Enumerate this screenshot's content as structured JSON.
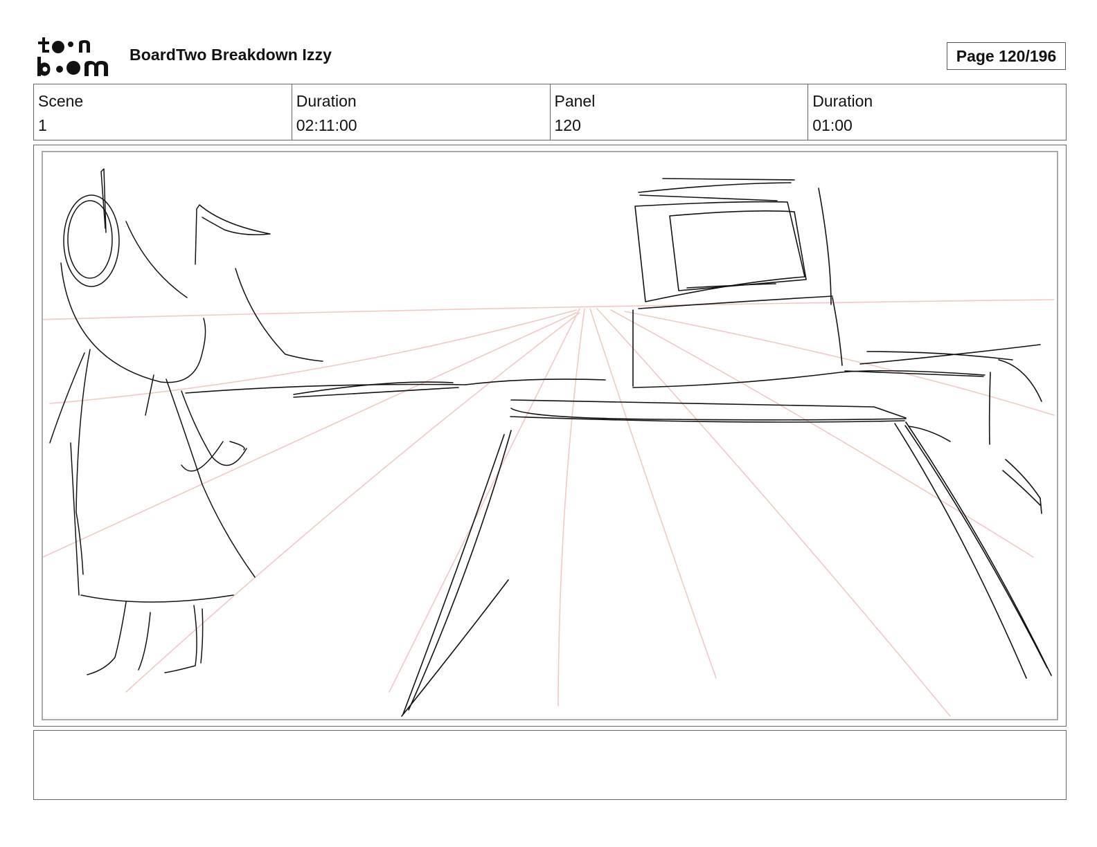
{
  "header": {
    "logo_text": "toon boom",
    "title": "BoardTwo Breakdown Izzy",
    "page_label": "Page 120/196"
  },
  "info": {
    "scene_label": "Scene",
    "scene_value": "1",
    "scene_duration_label": "Duration",
    "scene_duration_value": "02:11:00",
    "panel_label": "Panel",
    "panel_value": "120",
    "panel_duration_label": "Duration",
    "panel_duration_value": "01:00"
  },
  "notes": {
    "text": ""
  },
  "colors": {
    "sketch_line": "#111111",
    "perspective_line": "#f2c9c0",
    "frame_border": "#666666",
    "panel_border": "#a9a9a9"
  }
}
